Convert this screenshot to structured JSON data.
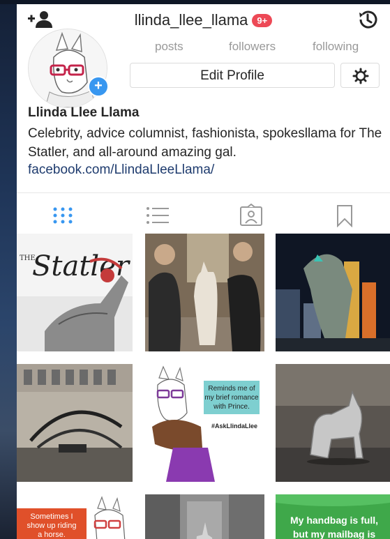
{
  "header": {
    "username": "llinda_llee_llama",
    "notification_badge": "9+"
  },
  "stats": {
    "posts_label": "posts",
    "followers_label": "followers",
    "following_label": "following"
  },
  "actions": {
    "edit_profile_label": "Edit Profile"
  },
  "profile": {
    "display_name": "Llinda Llee Llama",
    "bio": "Celebrity, advice columnist, fashionista, spokesllama for The Statler, and all-around amazing gal.",
    "website": "facebook.com/LlindaLleeLlama/"
  },
  "tabs": [
    "grid-view",
    "list-view",
    "tagged-view",
    "saved-view"
  ],
  "posts": [
    {
      "id": "post-1",
      "text": "The Statler"
    },
    {
      "id": "post-2",
      "text": ""
    },
    {
      "id": "post-3",
      "text": ""
    },
    {
      "id": "post-4",
      "text": ""
    },
    {
      "id": "post-5",
      "text": "Reminds me of my brief romance with Prince.",
      "hashtag": "#AskLlindaLlee"
    },
    {
      "id": "post-6",
      "text": ""
    },
    {
      "id": "post-7",
      "text": "Sometimes I show up riding a horse."
    },
    {
      "id": "post-8",
      "text": ""
    },
    {
      "id": "post-9",
      "text": "My handbag is full, but my mailbag is"
    }
  ],
  "colors": {
    "accent": "#3897f0",
    "badge": "#ed4956",
    "link": "#1e3b6e",
    "text": "#262626"
  }
}
